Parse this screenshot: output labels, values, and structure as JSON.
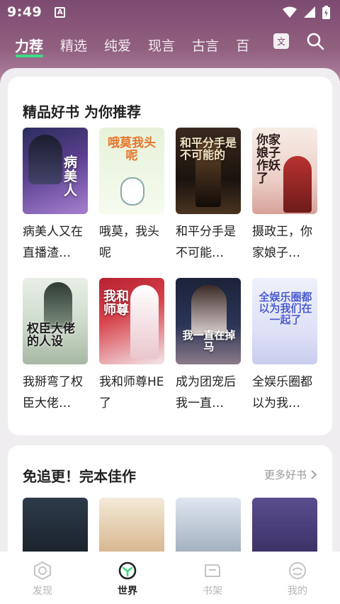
{
  "status_bar": {
    "time": "9:49",
    "a_badge": "A"
  },
  "tabs": [
    {
      "label": "力荐",
      "active": true
    },
    {
      "label": "精选"
    },
    {
      "label": "纯爱"
    },
    {
      "label": "现言"
    },
    {
      "label": "古言"
    },
    {
      "label": "百"
    }
  ],
  "tabs_more_icon_text": "文",
  "section1": {
    "title": "精品好书 为你推荐",
    "books": [
      {
        "title": "病美人又在直播渣…",
        "cover_text": "病美人"
      },
      {
        "title": "哦莫，我头呢",
        "cover_text": "哦莫我头呢"
      },
      {
        "title": "和平分手是不可能…",
        "cover_text": "和平分手是不可能的"
      },
      {
        "title": "摄政王，你家娘子…",
        "cover_text": "你家娘子作妖了"
      },
      {
        "title": "我掰弯了权臣大佬…",
        "cover_text": "权臣大佬的人设"
      },
      {
        "title": "我和师尊HE了",
        "cover_text": "我和师尊"
      },
      {
        "title": "成为团宠后我一直…",
        "cover_text": "我一直在掉马"
      },
      {
        "title": "全娱乐圈都以为我…",
        "cover_text": "全娱乐圈都以为我们在一起了"
      }
    ]
  },
  "section2": {
    "title": "免追更！完本佳作",
    "more_label": "更多好书"
  },
  "bottom_nav": [
    {
      "label": "发现",
      "icon": "discover-icon"
    },
    {
      "label": "世界",
      "icon": "world-icon",
      "active": true
    },
    {
      "label": "书架",
      "icon": "bookshelf-icon"
    },
    {
      "label": "我的",
      "icon": "profile-icon"
    }
  ],
  "colors": {
    "header": "#7d4a72",
    "tab_indicator": "#3ddc84",
    "active_nav": "#222222",
    "inactive_nav": "#b5b5b5"
  }
}
